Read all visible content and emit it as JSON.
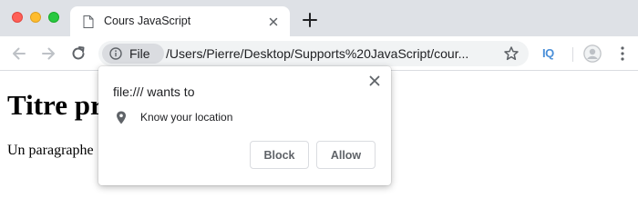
{
  "window": {
    "traffic_lights": [
      "close",
      "minimize",
      "maximize"
    ],
    "colors": {
      "close": "#fe5f57",
      "minimize": "#febc2e",
      "maximize": "#28c840"
    }
  },
  "tabs": [
    {
      "title": "Cours JavaScript",
      "favicon": "file-icon",
      "active": true
    }
  ],
  "new_tab_icon": "plus-icon",
  "toolbar": {
    "back_icon": "arrow-left-icon",
    "forward_icon": "arrow-right-icon",
    "reload_icon": "reload-icon",
    "site_chip_label": "File",
    "site_chip_icon": "info-icon",
    "url": "/Users/Pierre/Desktop/Supports%20JavaScript/cour...",
    "bookmark_icon": "star-icon",
    "extension_label": "IQ",
    "profile_icon": "profile-avatar-icon",
    "menu_icon": "kebab-menu-icon"
  },
  "page": {
    "heading": "Titre pr",
    "paragraph": "Un paragraphe"
  },
  "permission_popup": {
    "title": "file:/// wants to",
    "permission_icon": "location-pin-icon",
    "permission_label": "Know your location",
    "block_label": "Block",
    "allow_label": "Allow",
    "close_icon": "close-icon"
  }
}
